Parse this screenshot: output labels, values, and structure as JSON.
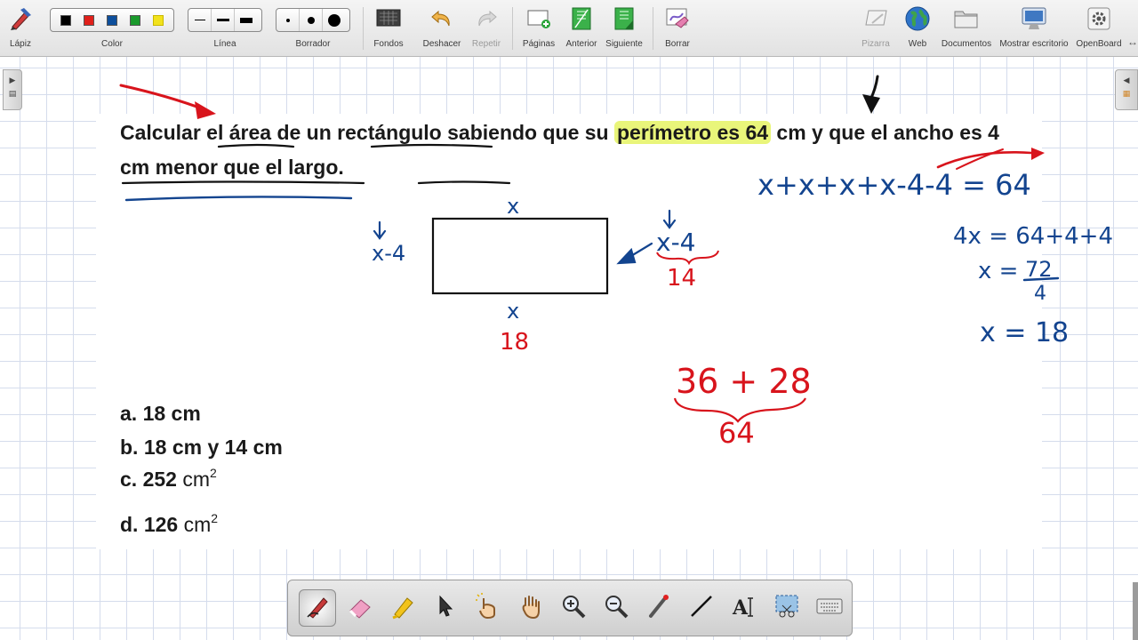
{
  "toolbar": {
    "pen_label": "Lápiz",
    "color_label": "Color",
    "line_label": "Línea",
    "eraser_label": "Borrador",
    "backgrounds_label": "Fondos",
    "undo_label": "Deshacer",
    "redo_label": "Repetir",
    "pages_label": "Páginas",
    "previous_label": "Anterior",
    "next_label": "Siguiente",
    "clear_label": "Borrar",
    "board_label": "Pizarra",
    "web_label": "Web",
    "documents_label": "Documentos",
    "show_desktop_label": "Mostrar escritorio",
    "openboard_label": "OpenBoard",
    "colors": [
      "#000000",
      "#e0201b",
      "#0e4f9c",
      "#1a9a2c",
      "#f2e21c"
    ]
  },
  "question": {
    "part1": "Calcular el área de un rectángulo sabiendo que su ",
    "highlight": "perímetro es 64",
    "part2": " cm y que el ancho es 4 cm menor que el largo."
  },
  "answers": {
    "a": {
      "letter": "a.",
      "value": "18 cm",
      "unit": "",
      "exp": ""
    },
    "b": {
      "letter": "b.",
      "value": "18 cm y 14 cm",
      "unit": "",
      "exp": ""
    },
    "c": {
      "letter": "c.",
      "value": "252",
      "unit": "cm",
      "exp": "2"
    },
    "d": {
      "letter": "d.",
      "value": "126",
      "unit": "cm",
      "exp": "2"
    }
  },
  "ink": {
    "top_x": "x",
    "left_side": "x-4",
    "right_side": "x-4",
    "right_value": "14",
    "bottom_x": "x",
    "bottom_value": "18",
    "equation1": "x+x+x+x-4-4 = 64",
    "equation2": "4x = 64+4+4",
    "equation3_lhs": "x =",
    "equation3_num": "72",
    "equation3_den": "4",
    "equation4": "x = 18",
    "sum_expr": "36 + 28",
    "sum_total": "64",
    "colors": {
      "blue": "#13448f",
      "red": "#d8141c",
      "black": "#111111",
      "highlight": "#e9f57a"
    }
  }
}
